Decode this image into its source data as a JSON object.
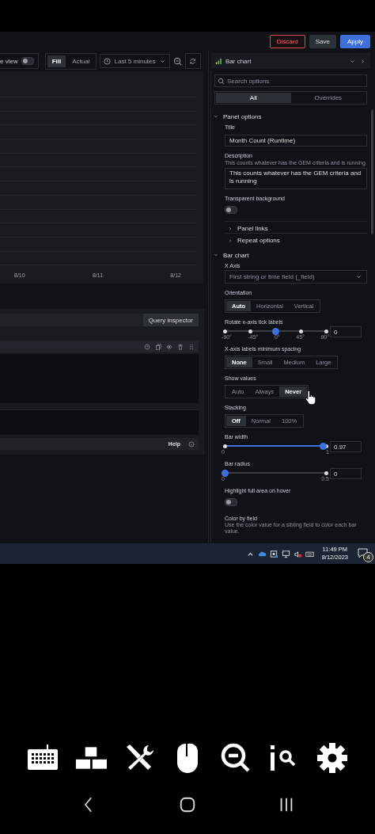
{
  "header": {
    "buttons": [
      {
        "label": "Discard",
        "kind": "danger"
      },
      {
        "label": "Save",
        "kind": "secondary"
      },
      {
        "label": "Apply",
        "kind": "primary"
      }
    ]
  },
  "toolbar": {
    "view_toggle": {
      "label": "e view",
      "on": false
    },
    "display_modes": [
      {
        "label": "Fill",
        "selected": true
      },
      {
        "label": "Actual",
        "selected": false
      }
    ],
    "time_range": "Last 5 minutes"
  },
  "graph": {
    "x_labels": [
      "8/10",
      "8/11",
      "8/12"
    ]
  },
  "query": {
    "inspector_button": "Query inspector",
    "help_button": "Help"
  },
  "visualization": {
    "label": "Bar chart"
  },
  "options": {
    "search": {
      "placeholder": "Search options"
    },
    "tabs": [
      {
        "label": "All",
        "selected": true
      },
      {
        "label": "Overrides",
        "selected": false
      }
    ],
    "sections": [
      {
        "title": "Panel options",
        "expanded": true,
        "items": [
          {
            "kind": "input",
            "label": "Title",
            "value": "Month Count (Runtime)"
          },
          {
            "kind": "textarea",
            "label": "Description",
            "hint": "This counts whatever has the GEM criteria and is running",
            "value": "This counts whatever has the GEM criteria and is running"
          },
          {
            "kind": "toggle",
            "label": "Transparent background",
            "on": false
          },
          {
            "kind": "group",
            "label": "Panel links",
            "expanded": false
          },
          {
            "kind": "group",
            "label": "Repeat options",
            "expanded": false
          }
        ]
      },
      {
        "title": "Bar chart",
        "expanded": true,
        "items": [
          {
            "kind": "select",
            "label": "X Axis",
            "value": "First string or time field (_field)"
          },
          {
            "kind": "radio",
            "label": "Orientation",
            "options": [
              {
                "label": "Auto",
                "selected": true
              },
              {
                "label": "Horizontal",
                "selected": false
              },
              {
                "label": "Vertical",
                "selected": false
              }
            ]
          },
          {
            "kind": "steps",
            "label": "Rotate x-axis tick labels",
            "level": 0.5,
            "value": "0",
            "ticks": [
              "-90°",
              "-45°",
              "0°",
              "45°",
              "90°"
            ]
          },
          {
            "kind": "radio",
            "label": "X-axis labels minimum spacing",
            "options": [
              {
                "label": "None",
                "selected": true
              },
              {
                "label": "Small",
                "selected": false
              },
              {
                "label": "Medium",
                "selected": false
              },
              {
                "label": "Large",
                "selected": false
              }
            ]
          },
          {
            "kind": "radio",
            "label": "Show values",
            "options": [
              {
                "label": "Auto",
                "selected": false
              },
              {
                "label": "Always",
                "selected": false
              },
              {
                "label": "Never",
                "selected": true
              }
            ]
          },
          {
            "kind": "radio",
            "label": "Stacking",
            "options": [
              {
                "label": "Off",
                "selected": true
              },
              {
                "label": "Normal",
                "selected": false
              },
              {
                "label": "100%",
                "selected": false
              }
            ]
          },
          {
            "kind": "slider",
            "label": "Bar width",
            "level": 0.97,
            "value": "0.97",
            "ticks": [
              "0",
              "1"
            ]
          },
          {
            "kind": "slider",
            "label": "Bar radius",
            "level": 0,
            "value": "0",
            "ticks": [
              "0",
              "0.5"
            ]
          },
          {
            "kind": "toggle",
            "label": "Highlight full area on hover",
            "on": false
          },
          {
            "kind": "info",
            "label": "Color by field",
            "description": "Use the color value for a sibling field to color each bar value."
          }
        ]
      }
    ]
  },
  "taskbar": {
    "time": "11:49 PM",
    "date": "8/12/2023",
    "notifications": "4"
  }
}
